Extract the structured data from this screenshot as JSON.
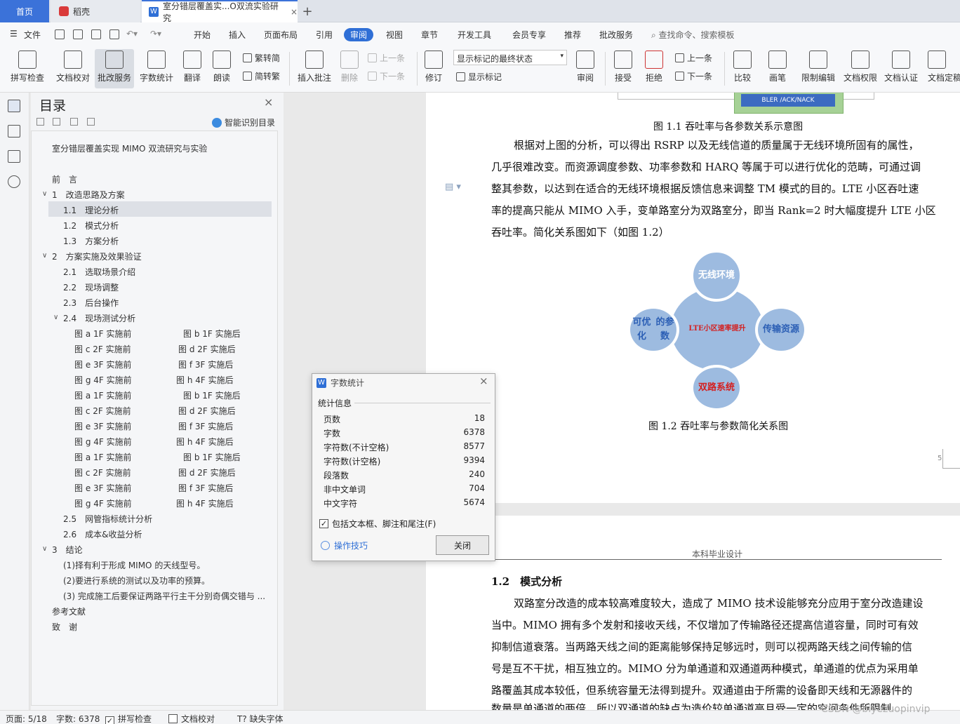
{
  "tabs": {
    "home": "首页",
    "daoke": "稻壳",
    "doc": "室分错层覆盖实...O双流实验研究",
    "new_tab": "+",
    "close": "×"
  },
  "menubar": {
    "file": "文件",
    "items": [
      "开始",
      "插入",
      "页面布局",
      "引用",
      "审阅",
      "视图",
      "章节",
      "开发工具",
      "会员专享",
      "推荐",
      "批改服务"
    ],
    "active": "审阅",
    "search": "查找命令、搜索模板"
  },
  "ribbon": {
    "spellcheck": "拼写检查",
    "doc_proof": "文档校对",
    "review_service": "批改服务",
    "word_count": "字数统计",
    "translate": "翻译",
    "read_aloud": "朗读",
    "trad_to_simp": "繁转简",
    "simp_to_trad": "简转繁",
    "insert_comment": "插入批注",
    "delete": "删除",
    "prev_comment": "上一条",
    "next_comment": "下一条",
    "revise": "修订",
    "markup_state": "显示标记的最终状态",
    "show_markup": "显示标记",
    "review_pane": "审阅",
    "accept": "接受",
    "reject": "拒绝",
    "prev_change": "上一条",
    "next_change": "下一条",
    "compare": "比较",
    "ink": "画笔",
    "restrict_edit": "限制编辑",
    "doc_permission": "文档权限",
    "doc_certify": "文档认证",
    "doc_finalize": "文档定稿"
  },
  "toc": {
    "title": "目录",
    "close": "×",
    "smart": "智能识别目录",
    "items": [
      {
        "text": "室分错层覆盖实现 MIMO 双流研究与实验"
      },
      {
        "text": "前　言"
      },
      {
        "text": "1　改造思路及方案"
      },
      {
        "text": "1.1　理论分析"
      },
      {
        "text": "1.2　模式分析"
      },
      {
        "text": "1.3　方案分析"
      },
      {
        "text": "2　方案实施及效果验证"
      },
      {
        "text": "2.1　选取场景介绍"
      },
      {
        "text": "2.2　现场调整"
      },
      {
        "text": "2.3　后台操作"
      },
      {
        "text": "2.4　现场测试分析"
      },
      {
        "text": "2.5　网管指标统计分析"
      },
      {
        "text": "2.6　成本&收益分析"
      },
      {
        "text": "3　结论"
      },
      {
        "text": "(1)择有利于形成 MIMO 的天线型号。"
      },
      {
        "text": "(2)要进行系统的测试以及功率的预算。"
      },
      {
        "text": "(3)  完成施工后要保证两路平行主干分别奇偶交错与 ..."
      },
      {
        "text": "参考文献"
      },
      {
        "text": "致　谢"
      }
    ],
    "fig_pairs": [
      [
        "图 a 1F 实施前",
        "图 b 1F 实施后"
      ],
      [
        "图 c 2F 实施前",
        "图 d 2F 实施后"
      ],
      [
        "图 e 3F 实施前",
        "图 f 3F 实施后"
      ],
      [
        "图 g 4F 实施前",
        "图 h 4F 实施后"
      ],
      [
        "图 a 1F 实施前",
        "图 b 1F 实施后"
      ],
      [
        "图 c 2F 实施前",
        "图 d 2F 实施后"
      ],
      [
        "图 e 3F 实施前",
        "图 f 3F 实施后"
      ],
      [
        "图 g 4F 实施前",
        "图 h 4F 实施后"
      ],
      [
        "图 a 1F 实施前",
        "图 b 1F 实施后"
      ],
      [
        "图 c 2F 实施前",
        "图 d 2F 实施后"
      ],
      [
        "图 e 3F 实施前",
        "图 f 3F 实施后"
      ],
      [
        "图 g 4F 实施前",
        "图 h 4F 实施后"
      ]
    ]
  },
  "doc": {
    "fig11_box_text": "BLER /ACK/NACK",
    "fig11_caption": "图 1.1  吞吐率与各参数关系示意图",
    "para1": [
      "根据对上图的分析，可以得出 RSRP 以及无线信道的质量属于无线环境所固有的属性，",
      "几乎很难改变。而资源调度参数、功率参数和 HARQ 等属于可以进行优化的范畴，可通过调",
      "整其参数，以达到在适合的无线环境根据反馈信息来调整 TM 模式的目的。LTE 小区吞吐速",
      "率的提高只能从 MIMO 入手，变单路室分为双路室分，即当 Rank=2 时大幅度提升 LTE 小区",
      "吞吐率。简化关系图如下（如图 1.2）"
    ],
    "fig12": {
      "center": "LTE小区速率提升",
      "top": [
        "无线",
        "环境"
      ],
      "left": [
        "可优化",
        "的参数"
      ],
      "right": [
        "传输",
        "资源"
      ],
      "bottom": [
        "双路",
        "系统"
      ]
    },
    "fig12_caption": "图 1.2  吞吐率与参数简化关系图",
    "page_num": "5",
    "header": "本科毕业设计",
    "section": "1.2　模式分析",
    "para2": [
      "双路室分改造的成本较高难度较大，造成了 MIMO 技术设能够充分应用于室分改造建设",
      "当中。MIMO 拥有多个发射和接收天线，不仅增加了传输路径还提高信道容量，同时可有效",
      "抑制信道衰落。当两路天线之间的距离能够保持足够远时，则可以视两路天线之间传输的信",
      "号是互不干扰，相互独立的。MIMO 分为单通道和双通道两种模式，单通道的优点为采用单",
      "路覆盖其成本较低，但系统容量无法得到提升。双通道由于所需的设备即天线和无源器件的",
      "数量是单通道的两倍，所以双通道的缺点为造价较单通道高且受一定的空间条件所限制。"
    ]
  },
  "dialog": {
    "title": "字数统计",
    "close": "×",
    "section": "统计信息",
    "rows": [
      {
        "label": "页数",
        "value": "18"
      },
      {
        "label": "字数",
        "value": "6378"
      },
      {
        "label": "字符数(不计空格)",
        "value": "8577"
      },
      {
        "label": "字符数(计空格)",
        "value": "9394"
      },
      {
        "label": "段落数",
        "value": "240"
      },
      {
        "label": "非中文单词",
        "value": "704"
      },
      {
        "label": "中文字符",
        "value": "5674"
      }
    ],
    "include_label": "包括文本框、脚注和尾注(F)",
    "include_checked": true,
    "tips": "操作技巧",
    "close_btn": "关闭"
  },
  "status": {
    "page": "页面: 5/18",
    "words": "字数: 6378",
    "spell": "拼写检查",
    "proof": "文档校对",
    "missing_font": "缺失字体"
  },
  "watermark": "CSDN @biyezuopinvip"
}
